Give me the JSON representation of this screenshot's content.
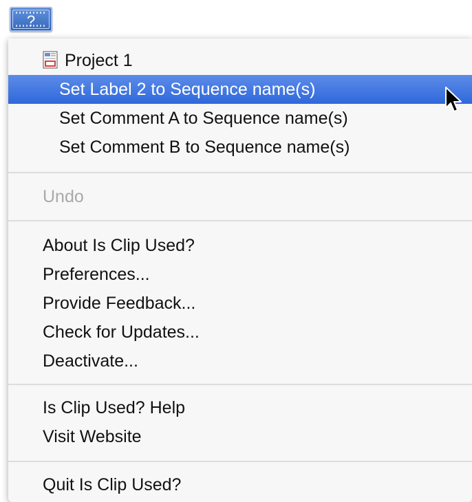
{
  "menubar": {
    "icon_glyph": "?"
  },
  "menu": {
    "project_label": "Project 1",
    "project_items": [
      "Set Label 2 to Sequence name(s)",
      "Set Comment A to Sequence name(s)",
      "Set Comment B to Sequence name(s)"
    ],
    "undo_label": "Undo",
    "app_items": [
      "About Is Clip Used?",
      "Preferences...",
      "Provide Feedback...",
      "Check for Updates...",
      "Deactivate..."
    ],
    "help_items": [
      "Is Clip Used? Help",
      "Visit Website"
    ],
    "quit_label": "Quit Is Clip Used?"
  },
  "colors": {
    "highlight": "#2f68db",
    "menu_bg": "#f7f7f7",
    "disabled_text": "#a9a9a9"
  }
}
